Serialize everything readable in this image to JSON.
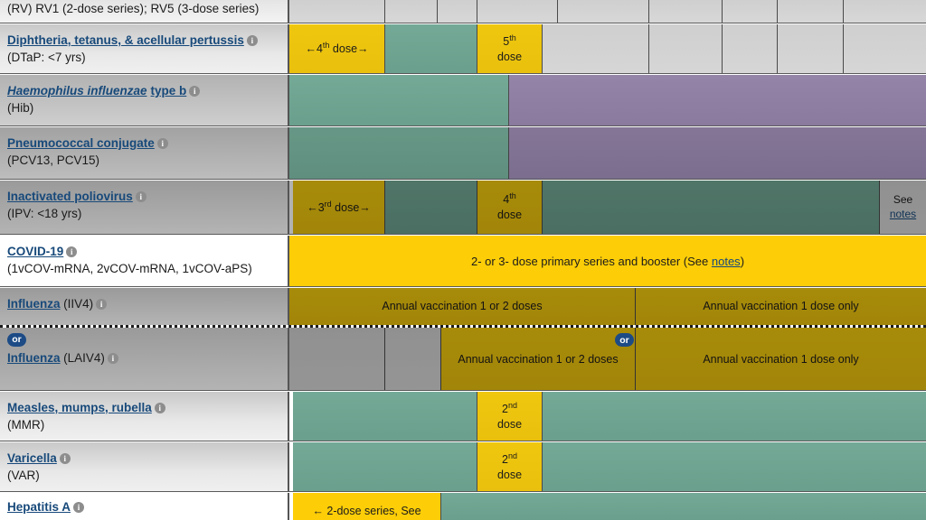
{
  "table": {
    "label_column_width": 320,
    "colors": {
      "yellow": "#EFC70E",
      "bright_yellow": "#FDCD07",
      "green": "#6EA492",
      "purple": "#8B7AA0",
      "grey": "#D2D2D2",
      "link_blue": "#17497A",
      "badge_blue": "#1C4B86"
    },
    "column_edges": [
      0,
      106,
      164,
      208,
      243,
      280,
      297,
      383,
      398,
      479,
      540,
      613,
      704
    ],
    "rows": [
      {
        "id": "rotavirus",
        "label_html": "(RV) RV1 (2-dose series); RV5 (3-dose series)",
        "label_plain": "(RV) RV1 (2-dose series); RV5 (3-dose series)",
        "partial_top": true,
        "cells": []
      },
      {
        "id": "dtap",
        "vaccine": "Diphtheria, tetanus, & acellular pertussis",
        "paren": "(DTaP: <7 yrs)",
        "cells": [
          {
            "text": "←4th dose→",
            "sup": "th",
            "color": "yellow"
          },
          {
            "text": "",
            "color": "green"
          },
          {
            "text": "5th dose",
            "sup": "th",
            "color": "yellow"
          },
          {
            "text": "",
            "color": "grey"
          }
        ]
      },
      {
        "id": "hib",
        "vaccine": "Haemophilus influenzae type b",
        "vaccine_italic": "Haemophilus influenzae",
        "vaccine_rest": " type b",
        "paren": "(Hib)",
        "cells": [
          {
            "text": "",
            "color": "green"
          },
          {
            "text": "",
            "color": "purple"
          }
        ]
      },
      {
        "id": "pcv",
        "vaccine": "Pneumococcal conjugate",
        "paren": "(PCV13, PCV15)",
        "cells": [
          {
            "text": "",
            "color": "green"
          },
          {
            "text": "",
            "color": "purple"
          }
        ]
      },
      {
        "id": "ipv",
        "vaccine": "Inactivated poliovirus",
        "paren": "(IPV: <18 yrs)",
        "cells": [
          {
            "text": "←3rd dose→",
            "sup": "rd",
            "color": "yellow"
          },
          {
            "text": "",
            "color": "green"
          },
          {
            "text": "4th dose",
            "sup": "th",
            "color": "yellow"
          },
          {
            "text": "",
            "color": "green"
          },
          {
            "text": "See notes",
            "color": "grey",
            "link": "notes"
          }
        ]
      },
      {
        "id": "covid19",
        "vaccine": "COVID-19",
        "paren": "(1vCOV-mRNA, 2vCOV-mRNA, 1vCOV-aPS)",
        "cells": [
          {
            "text": "2- or 3- dose primary series and booster (See notes)",
            "color": "bright_yellow",
            "link": "notes"
          }
        ]
      },
      {
        "id": "influenza-iiv4",
        "vaccine": "Influenza",
        "suffix": "(IIV4)",
        "cells": [
          {
            "text": "Annual vaccination 1 or 2 doses",
            "color": "yellow"
          },
          {
            "text": "Annual vaccination 1 dose only",
            "color": "yellow"
          }
        ]
      },
      {
        "id": "influenza-laiv4",
        "vaccine": "Influenza",
        "suffix": "(LAIV4)",
        "or_badge": "or",
        "cells": [
          {
            "text": "",
            "color": "grey"
          },
          {
            "text": "",
            "color": "grey"
          },
          {
            "text": "Annual vaccination 1 or 2 doses",
            "color": "yellow"
          },
          {
            "text": "Annual vaccination 1 dose only",
            "color": "yellow"
          }
        ]
      },
      {
        "id": "mmr",
        "vaccine": "Measles, mumps, rubella",
        "paren": "(MMR)",
        "cells": [
          {
            "text": "",
            "color": "green"
          },
          {
            "text": "2nd dose",
            "sup": "nd",
            "color": "yellow"
          },
          {
            "text": "",
            "color": "green"
          }
        ]
      },
      {
        "id": "varicella",
        "vaccine": "Varicella",
        "paren": "(VAR)",
        "cells": [
          {
            "text": "",
            "color": "green"
          },
          {
            "text": "2nd dose",
            "sup": "nd",
            "color": "yellow"
          },
          {
            "text": "",
            "color": "green"
          }
        ]
      },
      {
        "id": "hepatitis-a",
        "vaccine": "Hepatitis A",
        "paren": "",
        "partial_bottom": true,
        "cells": [
          {
            "text": "← 2-dose series, See",
            "color": "bright_yellow"
          },
          {
            "text": "",
            "color": "green"
          }
        ]
      }
    ]
  },
  "rotavirus_row": {
    "text": "(RV) RV1 (2-dose series); RV5 (3-dose series)"
  },
  "dtap_row": {
    "vaccine": "Diphtheria, tetanus, & acellular pertussis",
    "paren": "(DTaP: <7 yrs)",
    "dose4_pre": "←4",
    "dose4_sup": "th",
    "dose4_post": " dose→",
    "dose5_pre": "5",
    "dose5_sup": "th",
    "dose5_post": "dose"
  },
  "hib_row": {
    "vaccine_italic": "Haemophilus influenzae",
    "vaccine_rest": "type b",
    "paren": "(Hib)"
  },
  "pcv_row": {
    "vaccine": "Pneumococcal conjugate",
    "paren": "(PCV13, PCV15)"
  },
  "ipv_row": {
    "vaccine": "Inactivated poliovirus",
    "paren": "(IPV: <18 yrs)",
    "dose3_pre": "←3",
    "dose3_sup": "rd",
    "dose3_post": " dose→",
    "dose4_pre": "4",
    "dose4_sup": "th",
    "dose4_post": "dose",
    "see": "See",
    "notes": "notes"
  },
  "covid_row": {
    "vaccine": "COVID-19",
    "paren": "(1vCOV-mRNA, 2vCOV-mRNA, 1vCOV-aPS)",
    "text_pre": "2- or 3- dose primary series and booster (See ",
    "notes": "notes",
    "text_post": ")"
  },
  "iiv4_row": {
    "vaccine": "Influenza",
    "suffix": "(IIV4)",
    "left_text": "Annual vaccination 1 or 2 doses",
    "right_text": "Annual vaccination 1 dose only"
  },
  "laiv4_row": {
    "vaccine": "Influenza",
    "suffix": "(LAIV4)",
    "or_badge": "or",
    "left_text": "Annual vaccination 1 or 2 doses",
    "right_text": "Annual vaccination 1 dose only"
  },
  "mmr_row": {
    "vaccine": "Measles, mumps, rubella",
    "paren": "(MMR)",
    "dose_pre": "2",
    "dose_sup": "nd",
    "dose_post": "dose"
  },
  "var_row": {
    "vaccine": "Varicella",
    "paren": "(VAR)",
    "dose_pre": "2",
    "dose_sup": "nd",
    "dose_post": "dose"
  },
  "hepa_row": {
    "vaccine": "Hepatitis A",
    "text": "← 2-dose series, See"
  },
  "icons": {
    "info": "i",
    "info_name": "info-icon"
  }
}
